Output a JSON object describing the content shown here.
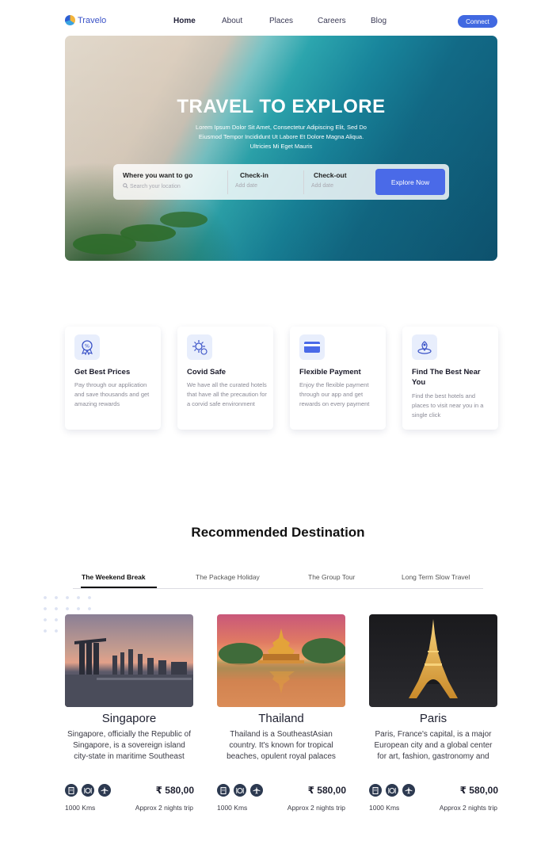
{
  "nav": {
    "logo_text": "Travelo",
    "links": [
      {
        "label": "Home",
        "active": true
      },
      {
        "label": "About",
        "active": false
      },
      {
        "label": "Places",
        "active": false
      },
      {
        "label": "Careers",
        "active": false
      },
      {
        "label": "Blog",
        "active": false
      }
    ],
    "connect_label": "Connect"
  },
  "hero": {
    "title": "TRAVEL TO EXPLORE",
    "subtitle": "Lorem Ipsum Dolor Sit Amet, Consectetur Adipiscing Elit, Sed Do Eiusmod Tempor Incididunt Ut Labore Et Dolore Magna Aliqua. Ultricies Mi Eget Mauris",
    "search": {
      "where_label": "Where you want to go",
      "where_placeholder": "Search your location",
      "checkin_label": "Check-in",
      "checkin_placeholder": "Add date",
      "checkout_label": "Check-out",
      "checkout_placeholder": "Add date",
      "button_label": "Explore Now"
    }
  },
  "features": [
    {
      "icon": "discount-badge-icon",
      "title": "Get Best Prices",
      "desc": "Pay through our application and save thousands and get amazing rewards"
    },
    {
      "icon": "virus-shield-icon",
      "title": "Covid Safe",
      "desc": "We have all the curated hotels that have all the precaution for a corvid safe environment"
    },
    {
      "icon": "credit-card-icon",
      "title": "Flexible Payment",
      "desc": "Enjoy the flexible payment through our app and get rewards on every payment"
    },
    {
      "icon": "location-pin-icon",
      "title": "Find The Best Near You",
      "desc": "Find the best hotels and places to visit near you in a single click"
    }
  ],
  "recommended": {
    "title": "Recommended Destination",
    "tabs": [
      {
        "label": "The Weekend Break",
        "active": true
      },
      {
        "label": "The Package Holiday",
        "active": false
      },
      {
        "label": "The Group Tour",
        "active": false
      },
      {
        "label": "Long Term Slow Travel",
        "active": false
      }
    ],
    "cards": [
      {
        "name": "Singapore",
        "desc": "Singapore, officially the Republic of Singapore, is a sovereign island city-state in maritime Southeast",
        "price": "₹ 580,00",
        "distance": "1000 Kms",
        "duration": "Approx 2 nights trip"
      },
      {
        "name": "Thailand",
        "desc": "Thailand is a SoutheastAsian country. It's known for tropical beaches, opulent royal palaces",
        "price": "₹ 580,00",
        "distance": "1000 Kms",
        "duration": "Approx 2 nights trip"
      },
      {
        "name": "Paris",
        "desc": "Paris, France's capital, is a major European city and a global center for art, fashion, gastronomy and",
        "price": "₹ 580,00",
        "distance": "1000 Kms",
        "duration": "Approx 2 nights trip"
      }
    ],
    "meta_icons": [
      "hotel-icon",
      "food-icon",
      "flight-icon"
    ]
  },
  "colors": {
    "accent": "#4169e1",
    "dark": "#2c3950"
  }
}
